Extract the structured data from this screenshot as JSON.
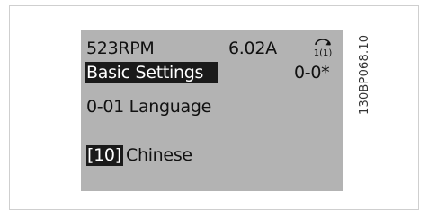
{
  "status_line": {
    "speed": "523RPM",
    "current": "6.02A",
    "setup_indicator": "1(1)"
  },
  "menu": {
    "title": "Basic Settings",
    "group": "0-0*"
  },
  "parameter": {
    "label": "0-01 Language"
  },
  "value": {
    "index": "[10]",
    "text": "Chinese"
  },
  "figure_id": "130BP068.10",
  "colors": {
    "display_bg": "#b3b3b3",
    "highlight": "#1a1a1a",
    "highlight_text": "#ffffff"
  }
}
